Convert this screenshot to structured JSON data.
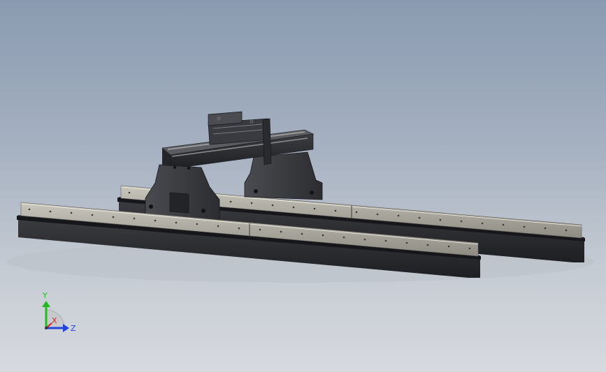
{
  "scene": {
    "model": "gantry-on-rails-assembly",
    "background_top": "#8a9bb1",
    "background_bottom": "#d7dadf",
    "steel_color": "#2f3034",
    "rail_face_color": "#a8a59b"
  },
  "triad": {
    "y_label": "Y",
    "z_label": "Z",
    "x_label": "X",
    "y_color": "#22bb22",
    "z_color": "#2244dd",
    "x_color": "#cc2222"
  }
}
